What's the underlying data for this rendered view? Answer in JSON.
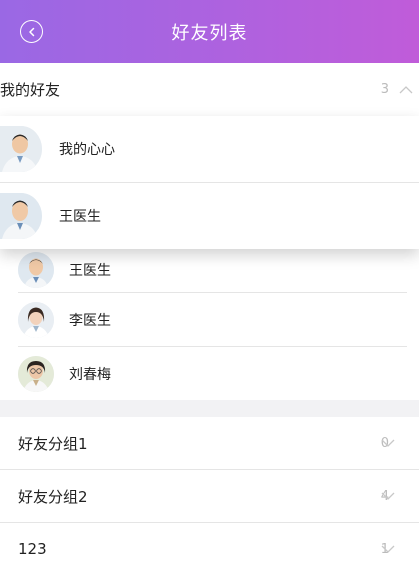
{
  "navbar": {
    "title": "好友列表",
    "back_icon": "back-circle-icon"
  },
  "my_friends": {
    "title": "我的好友",
    "count": "3",
    "expanded": true
  },
  "popup_items": [
    {
      "name": "我的心心"
    },
    {
      "name": "王医生"
    }
  ],
  "friends": [
    {
      "name": "王医生"
    },
    {
      "name": "李医生"
    },
    {
      "name": "刘春梅"
    }
  ],
  "groups": [
    {
      "title": "好友分组1",
      "count": "0"
    },
    {
      "title": "好友分组2",
      "count": "4"
    },
    {
      "title": "123",
      "count": "1"
    }
  ],
  "colors": {
    "nav_start": "#9a68e4",
    "nav_end": "#c05cd9",
    "divider": "#e5e5e5",
    "gap": "#f2f2f4"
  }
}
